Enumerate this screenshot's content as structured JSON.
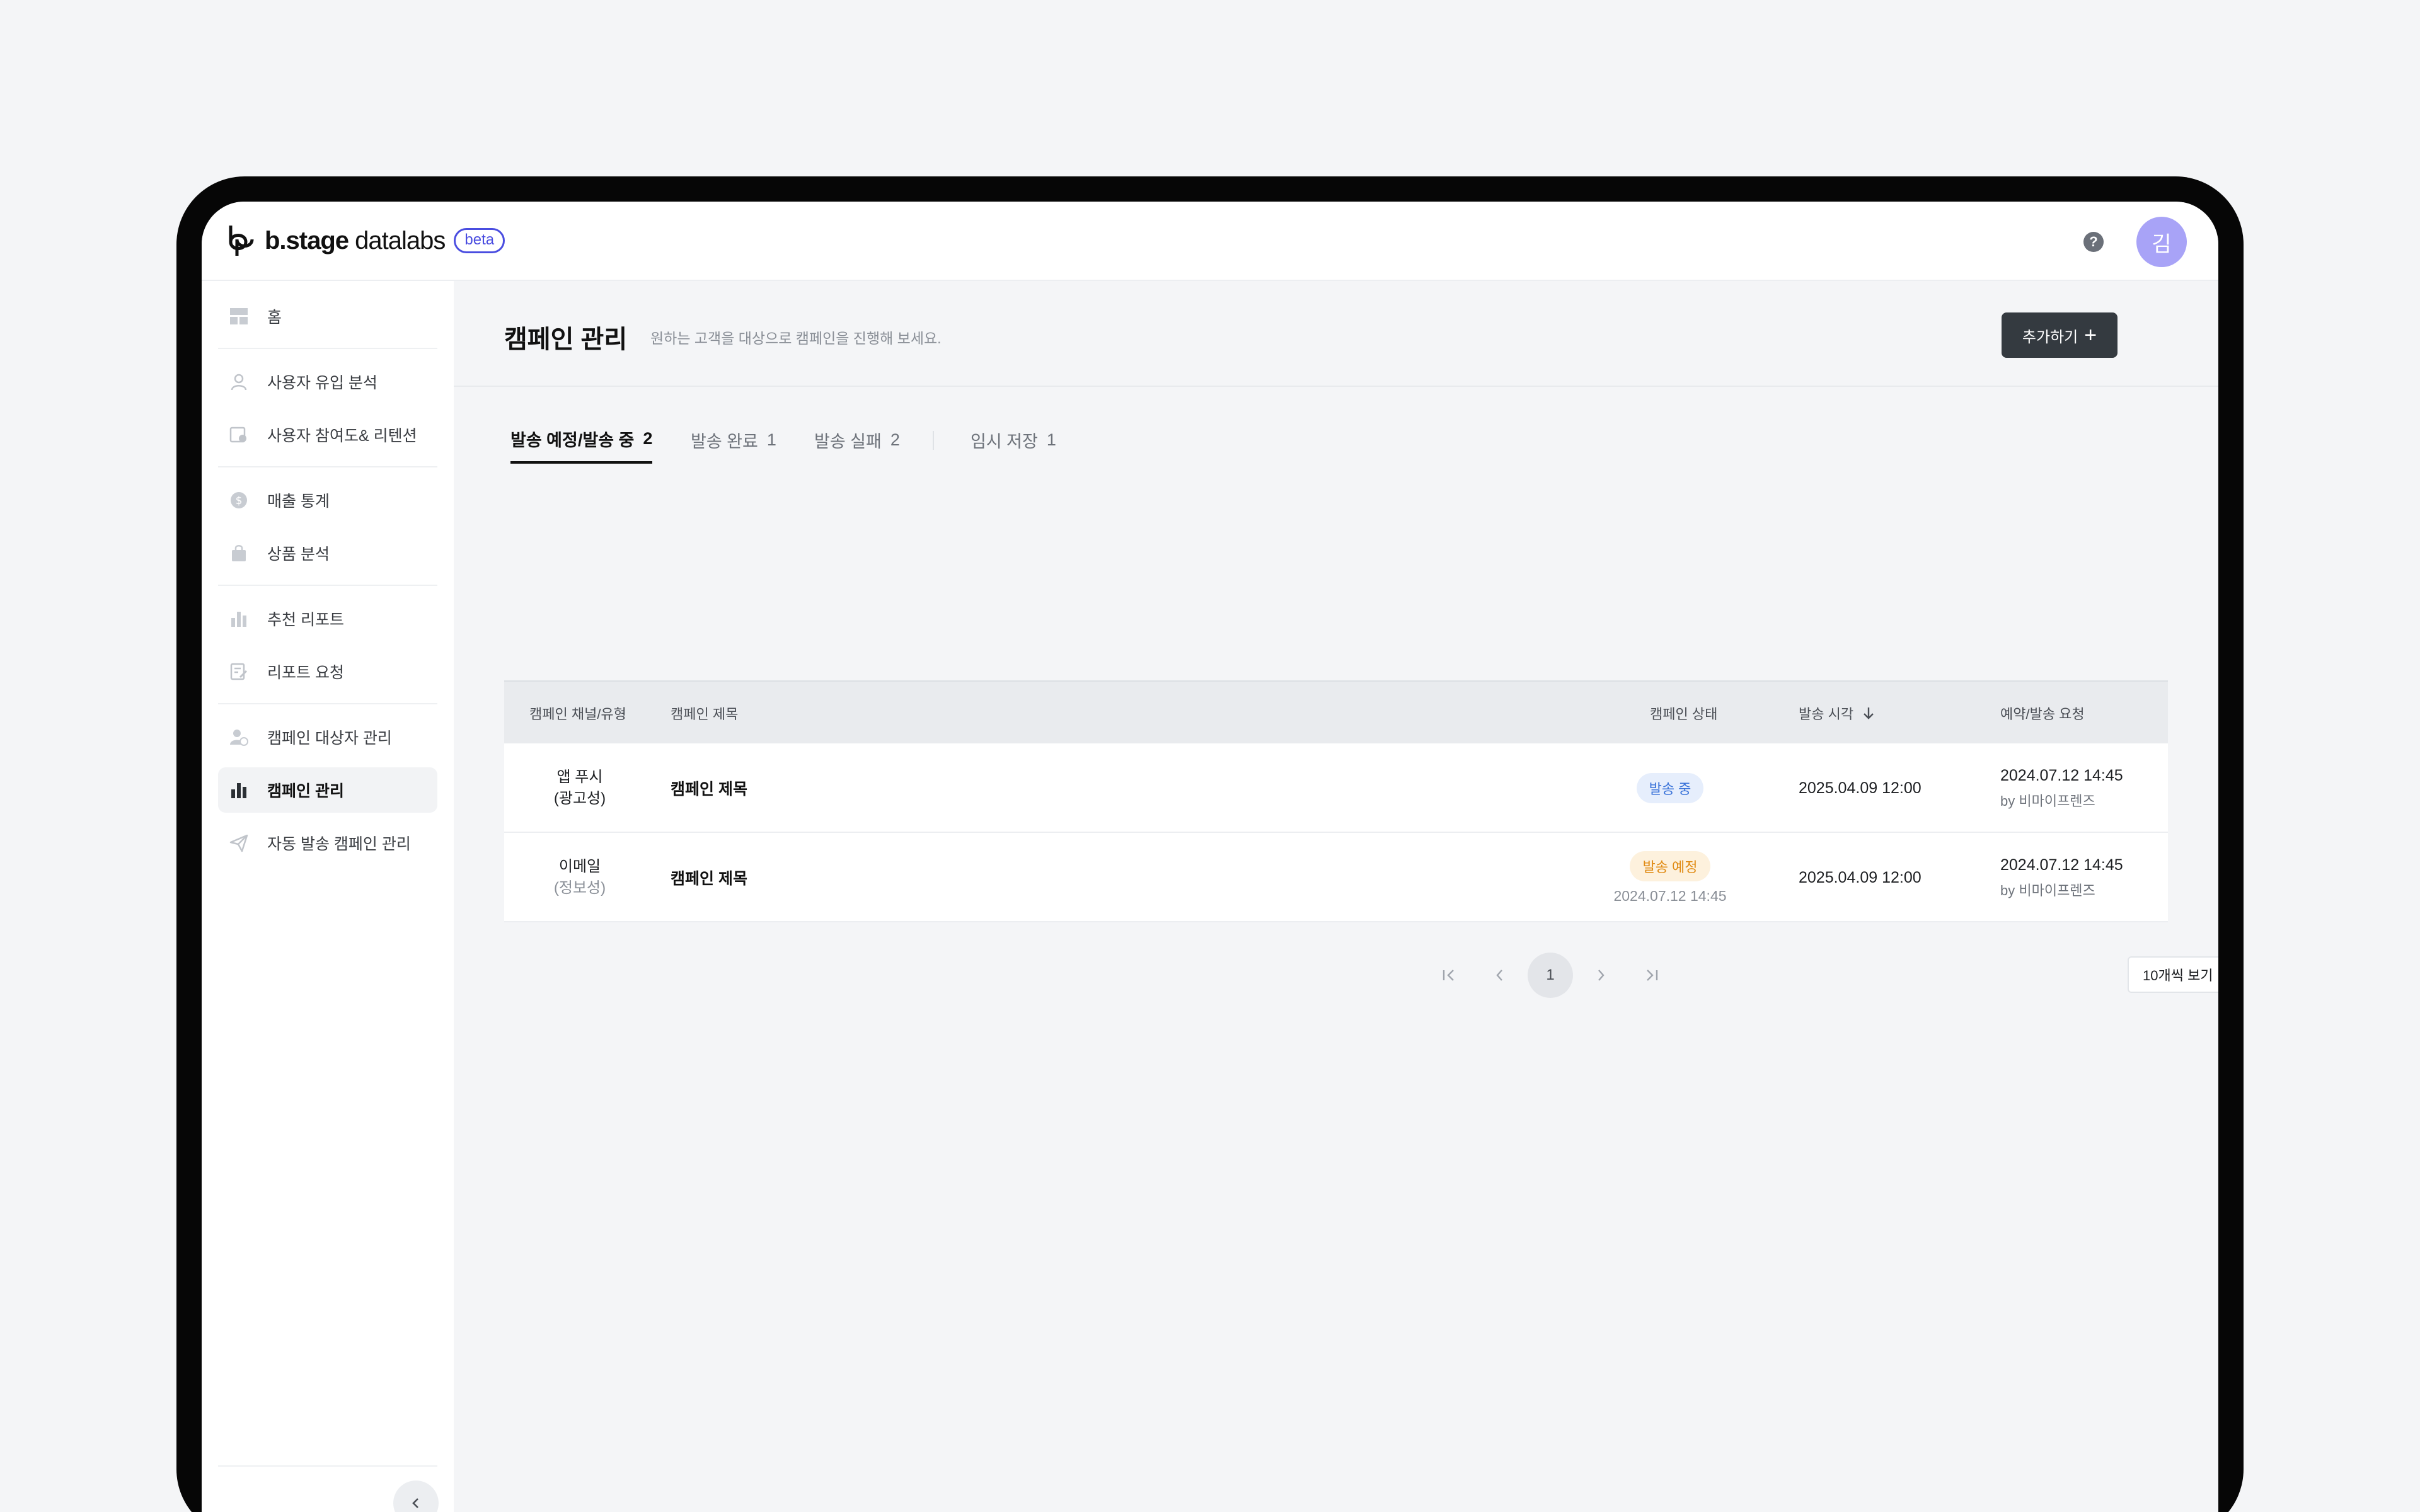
{
  "app": {
    "logo_brand": "b.stage",
    "logo_product": "datalabs",
    "beta_label": "beta",
    "help_icon": "help-circle-icon",
    "avatar_initial": "김"
  },
  "sidebar": {
    "items": [
      {
        "label": "홈",
        "icon": "dashboard-icon"
      },
      {
        "label": "사용자 유입 분석",
        "icon": "user-icon"
      },
      {
        "label": "사용자 참여도& 리텐션",
        "icon": "calendar-user-icon"
      },
      {
        "label": "매출 통계",
        "icon": "dollar-icon"
      },
      {
        "label": "상품 분석",
        "icon": "shopping-bag-icon"
      },
      {
        "label": "추천 리포트",
        "icon": "bar-chart-icon"
      },
      {
        "label": "리포트 요청",
        "icon": "edit-document-icon"
      },
      {
        "label": "캠페인 대상자 관리",
        "icon": "user-check-icon"
      },
      {
        "label": "캠페인 관리",
        "icon": "bar-chart-icon",
        "active": true
      },
      {
        "label": "자동 발송 캠페인 관리",
        "icon": "send-icon"
      }
    ]
  },
  "page": {
    "title": "캠페인 관리",
    "subtitle": "원하는 고객을 대상으로 캠페인을 진행해 보세요.",
    "add_button": "추가하기",
    "add_icon": "plus-icon"
  },
  "tabs": [
    {
      "label": "발송 예정/발송 중",
      "count": "2",
      "active": true
    },
    {
      "label": "발송 완료",
      "count": "1"
    },
    {
      "label": "발송 실패",
      "count": "2"
    },
    {
      "label": "임시 저장",
      "count": "1"
    }
  ],
  "table": {
    "headers": {
      "channel": "캠페인 채널/유형",
      "title": "캠페인 제목",
      "status": "캠페인 상태",
      "send_time": "발송 시각",
      "request": "예약/발송 요청"
    },
    "rows": [
      {
        "channel": "앱 푸시",
        "type": "(광고성)",
        "title": "캠페인 제목",
        "status": "발송 중",
        "status_color": "#3a73d9",
        "status_time": "",
        "send_time": "2025.04.09 12:00",
        "request_time": "2024.07.12 14:45",
        "request_by": "by 비마이프렌즈"
      },
      {
        "channel": "이메일",
        "type": "(정보성)",
        "title": "캠페인 제목",
        "status": "발송 예정",
        "status_color": "#e08a12",
        "status_time": "2024.07.12 14:45",
        "send_time": "2025.04.09 12:00",
        "request_time": "2024.07.12 14:45",
        "request_by": "by 비마이프렌즈"
      }
    ]
  },
  "pagination": {
    "current_page": "1",
    "page_size": "10개씩 보기"
  }
}
